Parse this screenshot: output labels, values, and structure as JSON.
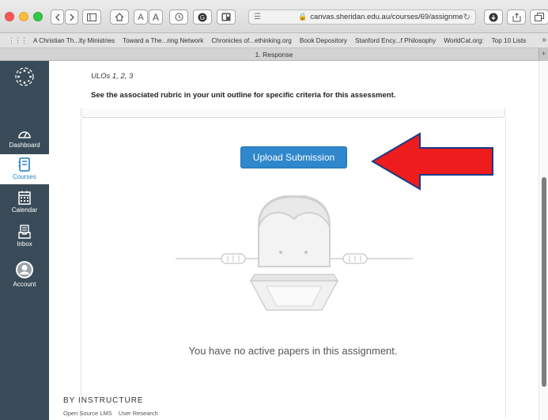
{
  "browser": {
    "url": "canvas.sheridan.edu.au/courses/69/assignme",
    "bookmarks": [
      "A Christian Th...lty Ministries",
      "Toward a The...ring Network",
      "Chronicles of...ethinking.org",
      "Book Depository",
      "Stanford Ency...f Philosophy",
      "WorldCat.org:",
      "Top 10 Lists"
    ],
    "bookmarks_more": "»",
    "tab_title": "1. Response",
    "tab_add": "+",
    "toolbar_font_small": "A",
    "toolbar_font_large": "A"
  },
  "nav": {
    "items": [
      {
        "label": "Dashboard",
        "icon": "dashboard-icon"
      },
      {
        "label": "Courses",
        "icon": "courses-icon",
        "active": true
      },
      {
        "label": "Calendar",
        "icon": "calendar-icon"
      },
      {
        "label": "Inbox",
        "icon": "inbox-icon"
      },
      {
        "label": "Account",
        "icon": "account-icon"
      }
    ],
    "accent_color": "#1f7fc7",
    "background_color": "#394b58"
  },
  "content": {
    "ulos": "ULOs 1, 2, 3",
    "rubric_note": "See the associated rubric in your unit outline for specific criteria for this assessment.",
    "upload_button": "Upload Submission",
    "empty_message": "You have no active papers in this assignment.",
    "upload_button_color": "#2f87cc",
    "annotation_arrow_color": "#ee1c1c"
  },
  "footer": {
    "brand": "BY INSTRUCTURE",
    "links": [
      "Open Source LMS",
      "User Research"
    ]
  }
}
